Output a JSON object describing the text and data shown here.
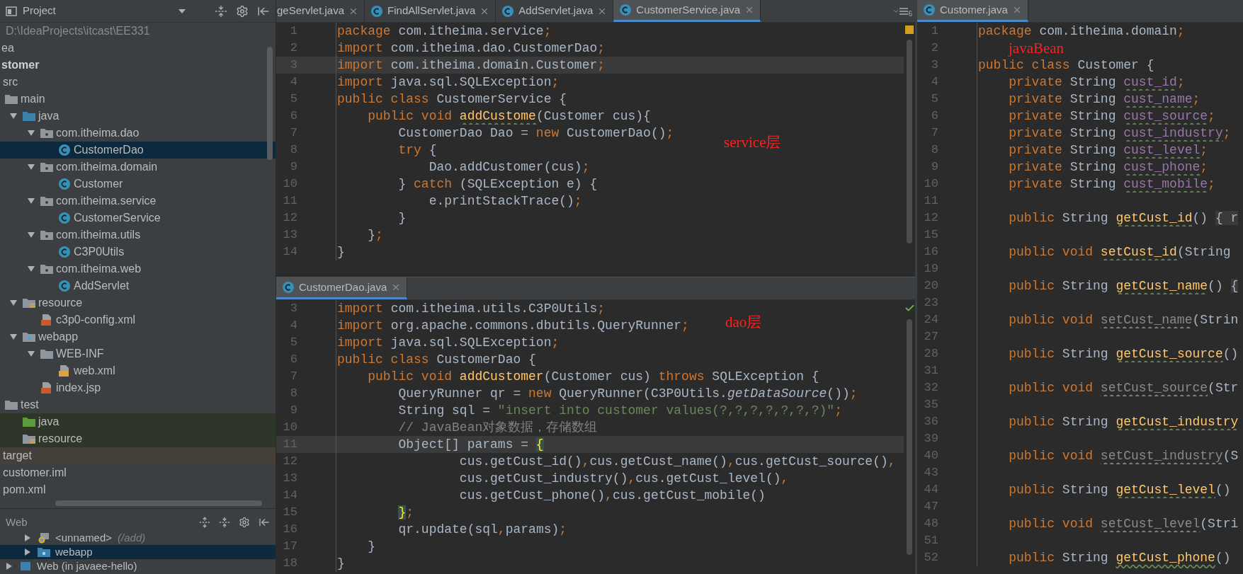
{
  "project_panel": {
    "title": "Project",
    "project_path": "D:\\IdeaProjects\\itcast\\EE331",
    "tree": [
      {
        "kind": "folder",
        "label": "ea",
        "selected": false
      },
      {
        "kind": "module",
        "label": "stomer",
        "selected": false,
        "children": [
          {
            "kind": "folder",
            "label": "src",
            "selected": false,
            "children": [
              {
                "kind": "folder",
                "label": "main",
                "selected": false,
                "children": [
                  {
                    "kind": "source-folder",
                    "label": "java",
                    "selected": false,
                    "expanded": true,
                    "children": [
                      {
                        "kind": "package",
                        "label": "com.itheima.dao",
                        "selected": false,
                        "expanded": true,
                        "children": [
                          {
                            "kind": "class",
                            "label": "CustomerDao",
                            "selected": true
                          }
                        ]
                      },
                      {
                        "kind": "package",
                        "label": "com.itheima.domain",
                        "selected": false,
                        "expanded": true,
                        "children": [
                          {
                            "kind": "class",
                            "label": "Customer",
                            "selected": false
                          }
                        ]
                      },
                      {
                        "kind": "package",
                        "label": "com.itheima.service",
                        "selected": false,
                        "expanded": true,
                        "children": [
                          {
                            "kind": "class",
                            "label": "CustomerService",
                            "selected": false
                          }
                        ]
                      },
                      {
                        "kind": "package",
                        "label": "com.itheima.utils",
                        "selected": false,
                        "expanded": true,
                        "children": [
                          {
                            "kind": "class",
                            "label": "C3P0Utils",
                            "selected": false
                          }
                        ]
                      },
                      {
                        "kind": "package",
                        "label": "com.itheima.web",
                        "selected": false,
                        "expanded": true,
                        "children": [
                          {
                            "kind": "class",
                            "label": "AddServlet",
                            "selected": false
                          }
                        ]
                      }
                    ]
                  },
                  {
                    "kind": "resource-folder",
                    "label": "resource",
                    "selected": false,
                    "expanded": true,
                    "children": [
                      {
                        "kind": "xml-file",
                        "label": "c3p0-config.xml",
                        "selected": false
                      }
                    ]
                  },
                  {
                    "kind": "web-folder",
                    "label": "webapp",
                    "selected": false,
                    "expanded": true,
                    "children": [
                      {
                        "kind": "folder",
                        "label": "WEB-INF",
                        "selected": false,
                        "expanded": true,
                        "children": [
                          {
                            "kind": "web-xml-file",
                            "label": "web.xml",
                            "selected": false
                          }
                        ]
                      },
                      {
                        "kind": "jsp-file",
                        "label": "index.jsp",
                        "selected": false
                      }
                    ]
                  }
                ]
              },
              {
                "kind": "folder",
                "label": "test",
                "selected": false,
                "children": [
                  {
                    "kind": "test-source-folder",
                    "label": "java",
                    "selected": false
                  },
                  {
                    "kind": "test-resource-folder",
                    "label": "resource",
                    "selected": false
                  }
                ]
              }
            ]
          },
          {
            "kind": "excluded-folder",
            "label": "target",
            "selected": false
          },
          {
            "kind": "file",
            "label": "customer.iml",
            "selected": false
          },
          {
            "kind": "file",
            "label": "pom.xml",
            "selected": false
          }
        ]
      }
    ]
  },
  "web_panel": {
    "title": "Web",
    "items": [
      {
        "kind": "artifact",
        "label": "<unnamed>",
        "hint": "(/add)",
        "expanded": false,
        "selected": false
      },
      {
        "kind": "web-root",
        "label": "webapp",
        "expanded": false,
        "selected": true
      },
      {
        "kind": "facet",
        "label": "Web (in javaee-hello)",
        "expanded": false,
        "selected": false
      }
    ]
  },
  "main_editor": {
    "warnings": true,
    "hidden_tabs_count": "6",
    "annotation": "service层",
    "tabs": [
      {
        "label": "geServlet.java",
        "selected": false
      },
      {
        "label": "FindAllServlet.java",
        "selected": false
      },
      {
        "label": "AddServlet.java",
        "selected": false
      },
      {
        "label": "CustomerService.java",
        "selected": true
      }
    ],
    "lines": [
      {
        "no": "1",
        "current": false,
        "tokens": [
          {
            "kind": "kw",
            "text": "package "
          },
          {
            "kind": "plain",
            "text": "com.itheima.service"
          },
          {
            "kind": "kw",
            "text": ";"
          }
        ]
      },
      {
        "no": "2",
        "current": false,
        "tokens": [
          {
            "kind": "kw",
            "text": "import "
          },
          {
            "kind": "plain",
            "text": "com.itheima.dao.CustomerDao"
          },
          {
            "kind": "kw",
            "text": ";"
          }
        ]
      },
      {
        "no": "3",
        "current": true,
        "tokens": [
          {
            "kind": "kw",
            "text": "import "
          },
          {
            "kind": "plain",
            "text": "com.itheima.domain.Customer"
          },
          {
            "kind": "kw",
            "text": ";"
          }
        ]
      },
      {
        "no": "4",
        "current": false,
        "tokens": [
          {
            "kind": "kw",
            "text": "import "
          },
          {
            "kind": "plain",
            "text": "java.sql.SQLException"
          },
          {
            "kind": "kw",
            "text": ";"
          }
        ]
      },
      {
        "no": "5",
        "current": false,
        "tokens": [
          {
            "kind": "kw",
            "text": "public class "
          },
          {
            "kind": "plain",
            "text": "CustomerService {"
          }
        ]
      },
      {
        "no": "6",
        "current": false,
        "tokens": [
          {
            "kind": "kw",
            "text": "    public void "
          },
          {
            "kind": "method-warn",
            "text": "addCustome"
          },
          {
            "kind": "plain",
            "text": "(Customer cus){"
          }
        ]
      },
      {
        "no": "7",
        "current": false,
        "tokens": [
          {
            "kind": "plain",
            "text": "        CustomerDao Dao = "
          },
          {
            "kind": "kw",
            "text": "new "
          },
          {
            "kind": "plain",
            "text": "CustomerDao()"
          },
          {
            "kind": "kw",
            "text": ";"
          }
        ]
      },
      {
        "no": "8",
        "current": false,
        "tokens": [
          {
            "kind": "kw",
            "text": "        try "
          },
          {
            "kind": "plain",
            "text": "{"
          }
        ]
      },
      {
        "no": "9",
        "current": false,
        "tokens": [
          {
            "kind": "plain",
            "text": "            Dao.addCustomer(cus)"
          },
          {
            "kind": "kw",
            "text": ";"
          }
        ]
      },
      {
        "no": "10",
        "current": false,
        "tokens": [
          {
            "kind": "plain",
            "text": "        } "
          },
          {
            "kind": "kw",
            "text": "catch "
          },
          {
            "kind": "plain",
            "text": "(SQLException e) {"
          }
        ]
      },
      {
        "no": "11",
        "current": false,
        "tokens": [
          {
            "kind": "plain",
            "text": "            e.printStackTrace()"
          },
          {
            "kind": "kw",
            "text": ";"
          }
        ]
      },
      {
        "no": "12",
        "current": false,
        "tokens": [
          {
            "kind": "plain",
            "text": "        }"
          }
        ]
      },
      {
        "no": "13",
        "current": false,
        "tokens": [
          {
            "kind": "plain",
            "text": "    }"
          },
          {
            "kind": "kw",
            "text": ";"
          }
        ]
      },
      {
        "no": "14",
        "current": false,
        "tokens": [
          {
            "kind": "plain",
            "text": "}"
          }
        ]
      }
    ]
  },
  "bottom_editor": {
    "warnings": false,
    "annotation": "dao层",
    "tabs": [
      {
        "label": "CustomerDao.java",
        "selected": true
      }
    ],
    "lines": [
      {
        "no": "3",
        "current": false,
        "tokens": [
          {
            "kind": "kw",
            "text": "import "
          },
          {
            "kind": "plain",
            "text": "com.itheima.utils.C3P0Utils"
          },
          {
            "kind": "kw",
            "text": ";"
          }
        ]
      },
      {
        "no": "4",
        "current": false,
        "tokens": [
          {
            "kind": "kw",
            "text": "import "
          },
          {
            "kind": "plain",
            "text": "org.apache.commons.dbutils.QueryRunner"
          },
          {
            "kind": "kw",
            "text": ";"
          }
        ]
      },
      {
        "no": "5",
        "current": false,
        "tokens": [
          {
            "kind": "kw",
            "text": "import "
          },
          {
            "kind": "plain",
            "text": "java.sql.SQLException"
          },
          {
            "kind": "kw",
            "text": ";"
          }
        ]
      },
      {
        "no": "6",
        "current": false,
        "tokens": [
          {
            "kind": "kw",
            "text": "public class "
          },
          {
            "kind": "plain",
            "text": "CustomerDao {"
          }
        ]
      },
      {
        "no": "7",
        "current": false,
        "tokens": [
          {
            "kind": "kw",
            "text": "    public void "
          },
          {
            "kind": "method",
            "text": "addCustomer"
          },
          {
            "kind": "plain",
            "text": "(Customer cus) "
          },
          {
            "kind": "kw",
            "text": "throws "
          },
          {
            "kind": "plain",
            "text": "SQLException {"
          }
        ]
      },
      {
        "no": "8",
        "current": false,
        "tokens": [
          {
            "kind": "plain",
            "text": "        QueryRunner qr = "
          },
          {
            "kind": "kw",
            "text": "new "
          },
          {
            "kind": "plain",
            "text": "QueryRunner(C3P0Utils."
          },
          {
            "kind": "italic",
            "text": "getDataSource"
          },
          {
            "kind": "plain",
            "text": "())"
          },
          {
            "kind": "kw",
            "text": ";"
          }
        ]
      },
      {
        "no": "9",
        "current": false,
        "tokens": [
          {
            "kind": "plain",
            "text": "        String sql = "
          },
          {
            "kind": "str",
            "text": "\"insert into customer values(?,?,?,?,?,?,?)\""
          },
          {
            "kind": "kw",
            "text": ";"
          }
        ]
      },
      {
        "no": "10",
        "current": false,
        "tokens": [
          {
            "kind": "comment",
            "text": "        // JavaBean对象数据，存储数组"
          }
        ]
      },
      {
        "no": "11",
        "current": true,
        "tokens": [
          {
            "kind": "plain",
            "text": "        Object[] params = "
          },
          {
            "kind": "brace",
            "text": "{"
          }
        ]
      },
      {
        "no": "12",
        "current": false,
        "tokens": [
          {
            "kind": "plain",
            "text": "                cus.getCust_id()"
          },
          {
            "kind": "kw",
            "text": ","
          },
          {
            "kind": "plain",
            "text": "cus.getCust_name()"
          },
          {
            "kind": "kw",
            "text": ","
          },
          {
            "kind": "plain",
            "text": "cus.getCust_source()"
          },
          {
            "kind": "kw",
            "text": ","
          }
        ]
      },
      {
        "no": "13",
        "current": false,
        "tokens": [
          {
            "kind": "plain",
            "text": "                cus.getCust_industry()"
          },
          {
            "kind": "kw",
            "text": ","
          },
          {
            "kind": "plain",
            "text": "cus.getCust_level()"
          },
          {
            "kind": "kw",
            "text": ","
          }
        ]
      },
      {
        "no": "14",
        "current": false,
        "tokens": [
          {
            "kind": "plain",
            "text": "                cus.getCust_phone()"
          },
          {
            "kind": "kw",
            "text": ","
          },
          {
            "kind": "plain",
            "text": "cus.getCust_mobile()"
          }
        ]
      },
      {
        "no": "15",
        "current": false,
        "tokens": [
          {
            "kind": "brace",
            "text": "        }"
          },
          {
            "kind": "kw",
            "text": ";"
          }
        ]
      },
      {
        "no": "16",
        "current": false,
        "tokens": [
          {
            "kind": "plain",
            "text": "        qr.update(sql"
          },
          {
            "kind": "kw",
            "text": ","
          },
          {
            "kind": "plain",
            "text": "params)"
          },
          {
            "kind": "kw",
            "text": ";"
          }
        ]
      },
      {
        "no": "17",
        "current": false,
        "tokens": [
          {
            "kind": "plain",
            "text": "    }"
          }
        ]
      },
      {
        "no": "18",
        "current": false,
        "tokens": [
          {
            "kind": "plain",
            "text": "}"
          }
        ]
      }
    ]
  },
  "side_editor": {
    "annotation": "javaBean",
    "tabs": [
      {
        "label": "Customer.java",
        "selected": true
      }
    ],
    "lines": [
      {
        "no": "1",
        "current": false,
        "tokens": [
          {
            "kind": "kw",
            "text": "package "
          },
          {
            "kind": "plain",
            "text": "com.itheima.domain"
          },
          {
            "kind": "kw",
            "text": ";"
          }
        ]
      },
      {
        "no": "2",
        "current": false
      },
      {
        "no": "3",
        "current": false,
        "tokens": [
          {
            "kind": "kw",
            "text": "public class "
          },
          {
            "kind": "plain",
            "text": "Customer {"
          }
        ]
      },
      {
        "no": "4",
        "current": false,
        "tokens": [
          {
            "kind": "kw",
            "text": "    private "
          },
          {
            "kind": "plain",
            "text": "String "
          },
          {
            "kind": "field",
            "text": "cust_id"
          },
          {
            "kind": "kw",
            "text": ";"
          }
        ]
      },
      {
        "no": "5",
        "current": false,
        "tokens": [
          {
            "kind": "kw",
            "text": "    private "
          },
          {
            "kind": "plain",
            "text": "String "
          },
          {
            "kind": "field",
            "text": "cust_name"
          },
          {
            "kind": "kw",
            "text": ";"
          }
        ]
      },
      {
        "no": "6",
        "current": false,
        "tokens": [
          {
            "kind": "kw",
            "text": "    private "
          },
          {
            "kind": "plain",
            "text": "String "
          },
          {
            "kind": "field",
            "text": "cust_source"
          },
          {
            "kind": "kw",
            "text": ";"
          }
        ]
      },
      {
        "no": "7",
        "current": false,
        "tokens": [
          {
            "kind": "kw",
            "text": "    private "
          },
          {
            "kind": "plain",
            "text": "String "
          },
          {
            "kind": "field",
            "text": "cust_industry"
          },
          {
            "kind": "kw",
            "text": ";"
          }
        ]
      },
      {
        "no": "8",
        "current": false,
        "tokens": [
          {
            "kind": "kw",
            "text": "    private "
          },
          {
            "kind": "plain",
            "text": "String "
          },
          {
            "kind": "field",
            "text": "cust_level"
          },
          {
            "kind": "kw",
            "text": ";"
          }
        ]
      },
      {
        "no": "9",
        "current": false,
        "tokens": [
          {
            "kind": "kw",
            "text": "    private "
          },
          {
            "kind": "plain",
            "text": "String "
          },
          {
            "kind": "field",
            "text": "cust_phone"
          },
          {
            "kind": "kw",
            "text": ";"
          }
        ]
      },
      {
        "no": "10",
        "current": false,
        "tokens": [
          {
            "kind": "kw",
            "text": "    private "
          },
          {
            "kind": "plain",
            "text": "String "
          },
          {
            "kind": "field",
            "text": "cust_mobile"
          },
          {
            "kind": "kw",
            "text": ";"
          }
        ]
      },
      {
        "no": "11",
        "current": false
      },
      {
        "no": "12",
        "current": false,
        "tokens": [
          {
            "kind": "kw",
            "text": "    public "
          },
          {
            "kind": "plain",
            "text": "String "
          },
          {
            "kind": "method-warn",
            "text": "getCust_id"
          },
          {
            "kind": "plain",
            "text": "() "
          },
          {
            "kind": "folded",
            "text": "{ r"
          }
        ]
      },
      {
        "no": "15",
        "current": false
      },
      {
        "no": "16",
        "current": false,
        "tokens": [
          {
            "kind": "kw",
            "text": "    public void "
          },
          {
            "kind": "method-warn",
            "text": "setCust_id"
          },
          {
            "kind": "plain",
            "text": "(String"
          }
        ]
      },
      {
        "no": "19",
        "current": false
      },
      {
        "no": "20",
        "current": false,
        "tokens": [
          {
            "kind": "kw",
            "text": "    public "
          },
          {
            "kind": "plain",
            "text": "String "
          },
          {
            "kind": "method-warn",
            "text": "getCust_name"
          },
          {
            "kind": "plain",
            "text": "() "
          },
          {
            "kind": "folded",
            "text": "{"
          }
        ]
      },
      {
        "no": "23",
        "current": false
      },
      {
        "no": "24",
        "current": false,
        "tokens": [
          {
            "kind": "kw",
            "text": "    public void "
          },
          {
            "kind": "unused",
            "text": "setCust_name"
          },
          {
            "kind": "plain",
            "text": "(Strin"
          }
        ]
      },
      {
        "no": "27",
        "current": false
      },
      {
        "no": "28",
        "current": false,
        "tokens": [
          {
            "kind": "kw",
            "text": "    public "
          },
          {
            "kind": "plain",
            "text": "String "
          },
          {
            "kind": "method-warn",
            "text": "getCust_source"
          },
          {
            "kind": "plain",
            "text": "()"
          }
        ]
      },
      {
        "no": "31",
        "current": false
      },
      {
        "no": "32",
        "current": false,
        "tokens": [
          {
            "kind": "kw",
            "text": "    public void "
          },
          {
            "kind": "unused",
            "text": "setCust_source"
          },
          {
            "kind": "plain",
            "text": "(Str"
          }
        ]
      },
      {
        "no": "35",
        "current": false
      },
      {
        "no": "36",
        "current": false,
        "tokens": [
          {
            "kind": "kw",
            "text": "    public "
          },
          {
            "kind": "plain",
            "text": "String "
          },
          {
            "kind": "method-warn",
            "text": "getCust_industry"
          }
        ]
      },
      {
        "no": "39",
        "current": false
      },
      {
        "no": "40",
        "current": false,
        "tokens": [
          {
            "kind": "kw",
            "text": "    public void "
          },
          {
            "kind": "unused",
            "text": "setCust_industry"
          },
          {
            "kind": "plain",
            "text": "(S"
          }
        ]
      },
      {
        "no": "43",
        "current": false
      },
      {
        "no": "44",
        "current": false,
        "tokens": [
          {
            "kind": "kw",
            "text": "    public "
          },
          {
            "kind": "plain",
            "text": "String "
          },
          {
            "kind": "method-warn",
            "text": "getCust_level"
          },
          {
            "kind": "plain",
            "text": "()"
          }
        ]
      },
      {
        "no": "47",
        "current": false
      },
      {
        "no": "48",
        "current": false,
        "tokens": [
          {
            "kind": "kw",
            "text": "    public void "
          },
          {
            "kind": "unused",
            "text": "setCust_level"
          },
          {
            "kind": "plain",
            "text": "(Stri"
          }
        ]
      },
      {
        "no": "51",
        "current": false
      },
      {
        "no": "52",
        "current": false,
        "tokens": [
          {
            "kind": "kw",
            "text": "    public "
          },
          {
            "kind": "plain",
            "text": "String "
          },
          {
            "kind": "method-warn",
            "text": "getCust_phone"
          },
          {
            "kind": "plain",
            "text": "()"
          }
        ]
      }
    ]
  }
}
